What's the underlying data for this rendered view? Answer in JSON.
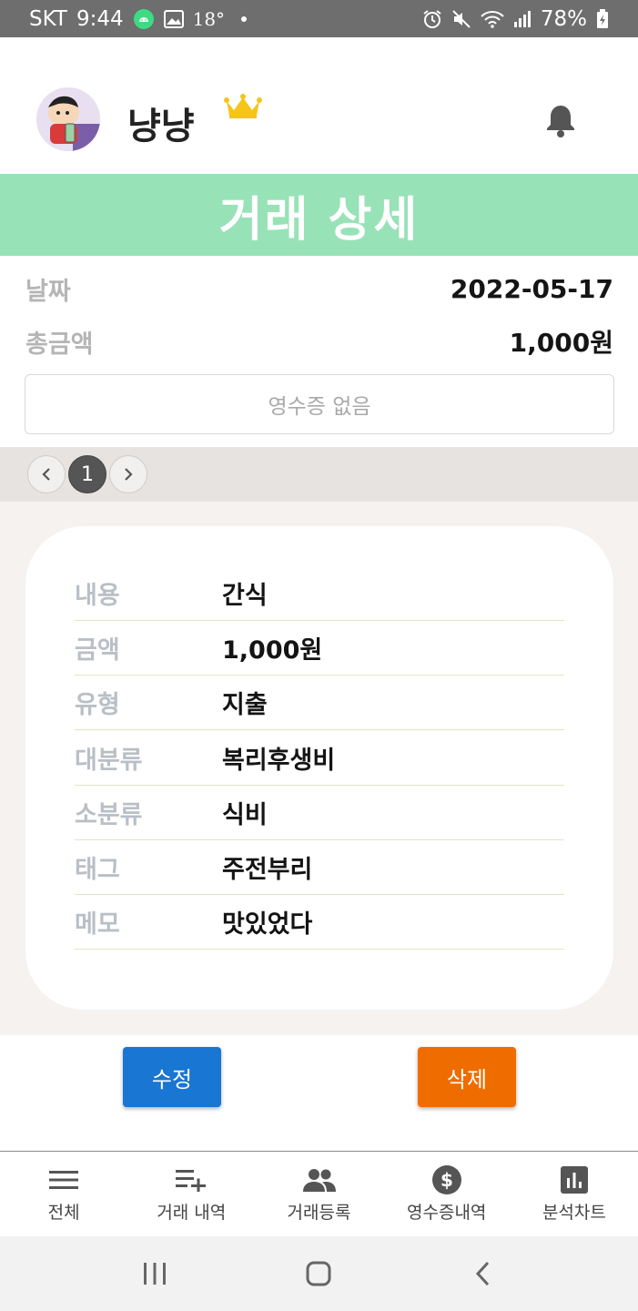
{
  "status_bar": {
    "carrier": "SKT",
    "time": "9:44",
    "temperature": "18°",
    "battery": "78%"
  },
  "header": {
    "username": "냥냥",
    "crown_color": "#f5c518"
  },
  "page": {
    "title": "거래 상세",
    "banner_color": "#98e2b7"
  },
  "summary": {
    "date_label": "날짜",
    "date_value": "2022-05-17",
    "total_label": "총금액",
    "total_value": "1,000원",
    "receipt_text": "영수증 없음"
  },
  "pager": {
    "current_page": "1"
  },
  "details": [
    {
      "label": "내용",
      "value": "간식"
    },
    {
      "label": "금액",
      "value": "1,000원"
    },
    {
      "label": "유형",
      "value": "지출"
    },
    {
      "label": "대분류",
      "value": "복리후생비"
    },
    {
      "label": "소분류",
      "value": "식비"
    },
    {
      "label": "태그",
      "value": "주전부리"
    },
    {
      "label": "메모",
      "value": "맛있었다"
    }
  ],
  "actions": {
    "edit_label": "수정",
    "edit_color": "#1976d2",
    "delete_label": "삭제",
    "delete_color": "#ef6c00"
  },
  "bottom_nav": [
    {
      "label": "전체",
      "icon": "menu-icon"
    },
    {
      "label": "거래 내역",
      "icon": "playlist-add-icon"
    },
    {
      "label": "거래등록",
      "icon": "people-icon"
    },
    {
      "label": "영수증내역",
      "icon": "dollar-circle-icon"
    },
    {
      "label": "분석차트",
      "icon": "bar-chart-icon"
    }
  ]
}
